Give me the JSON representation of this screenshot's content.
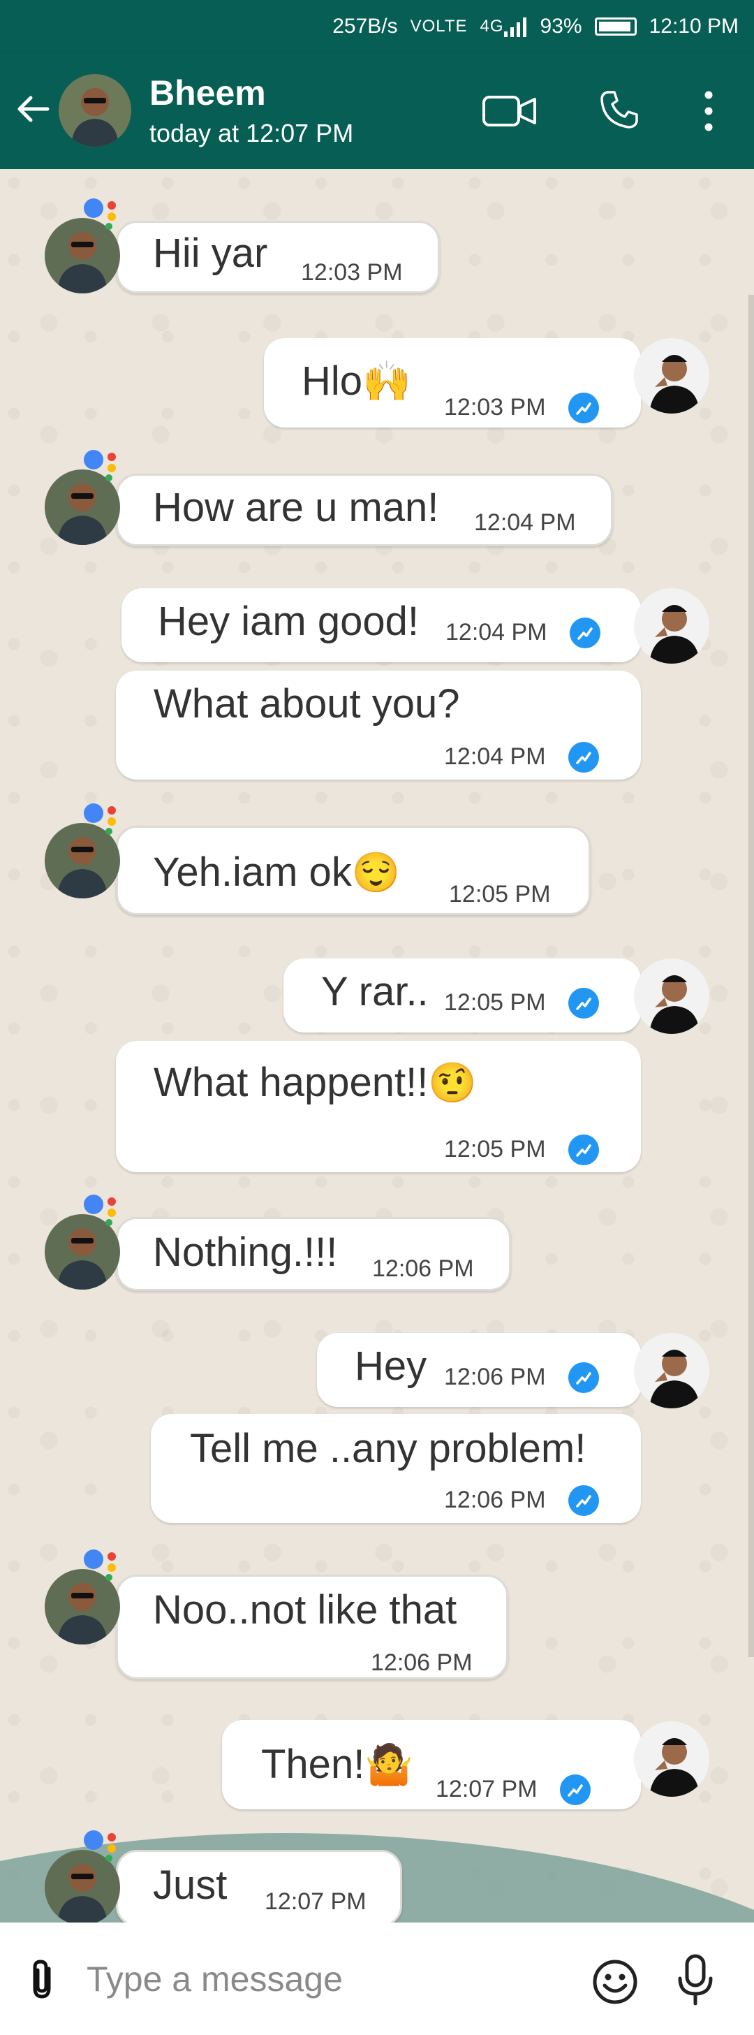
{
  "status_bar": {
    "speed": "257B/s",
    "network": "VOLTE",
    "lte": "4G",
    "battery": "93%",
    "time": "12:10 PM"
  },
  "header": {
    "name": "Bheem",
    "status": "today at 12:07 PM",
    "icons": [
      "back-arrow-icon",
      "video-call-icon",
      "phone-icon",
      "more-vertical-icon"
    ]
  },
  "messages": [
    {
      "dir": "in",
      "text": "Hii yar",
      "time": "12:03 PM"
    },
    {
      "dir": "out",
      "text": "Hlo",
      "emoji": "🙌",
      "time": "12:03 PM"
    },
    {
      "dir": "in",
      "text": "How are u man!",
      "time": "12:04 PM"
    },
    {
      "dir": "out",
      "text": "Hey iam good!",
      "time": "12:04 PM"
    },
    {
      "dir": "out",
      "text": "What about you?",
      "time": "12:04 PM"
    },
    {
      "dir": "in",
      "text": "Yeh.iam ok",
      "emoji": "😌",
      "time": "12:05 PM"
    },
    {
      "dir": "out",
      "text": "Y rar..",
      "time": "12:05 PM"
    },
    {
      "dir": "out",
      "text": "What happent!!",
      "emoji": "🤨",
      "time": "12:05 PM"
    },
    {
      "dir": "in",
      "text": "Nothing.!!!",
      "time": "12:06 PM"
    },
    {
      "dir": "out",
      "text": "Hey",
      "time": "12:06 PM"
    },
    {
      "dir": "out",
      "text": "Tell me ..any problem!",
      "time": "12:06 PM"
    },
    {
      "dir": "in",
      "text": "Noo..not like that",
      "time": "12:06 PM"
    },
    {
      "dir": "out",
      "text": "Then!",
      "emoji": "🤷",
      "time": "12:07 PM"
    },
    {
      "dir": "in",
      "text": "Just",
      "time": "12:07 PM"
    }
  ],
  "composer": {
    "placeholder": "Type a message"
  },
  "colors": {
    "header": "#075e54",
    "tick": "#2196f3",
    "chat_bg": "#ebe5dc",
    "wave": "#7fa39a"
  }
}
